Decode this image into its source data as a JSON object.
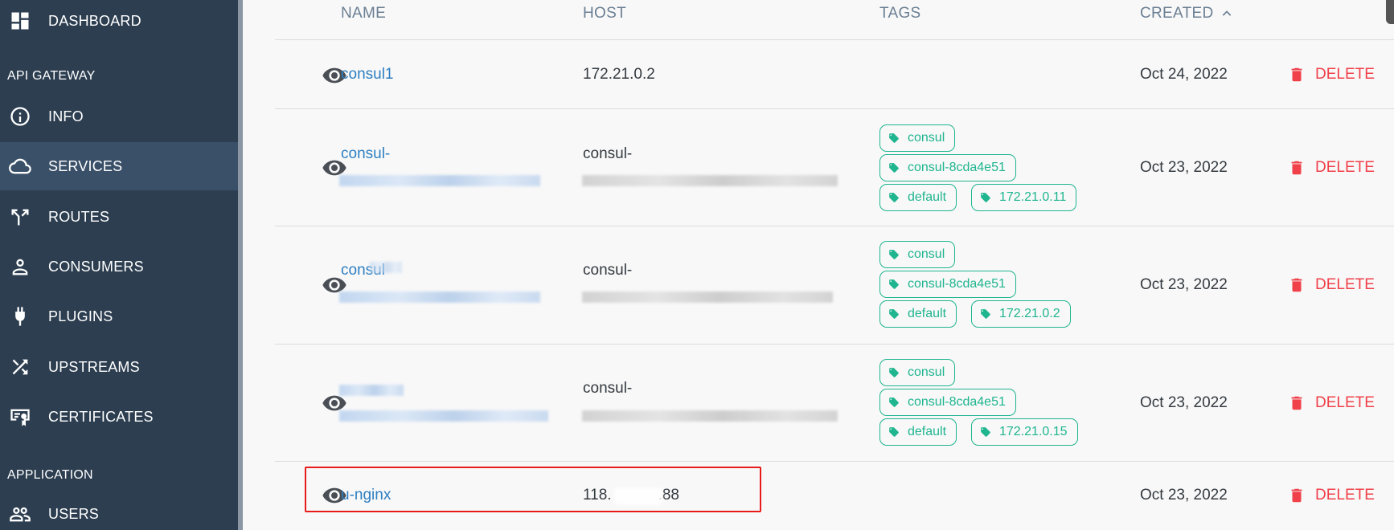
{
  "sidebar": {
    "items": [
      {
        "label": "DASHBOARD",
        "icon": "dashboard-icon"
      },
      {
        "label": "INFO",
        "icon": "info-icon"
      },
      {
        "label": "SERVICES",
        "icon": "cloud-icon"
      },
      {
        "label": "ROUTES",
        "icon": "routes-icon"
      },
      {
        "label": "CONSUMERS",
        "icon": "person-icon"
      },
      {
        "label": "PLUGINS",
        "icon": "plug-icon"
      },
      {
        "label": "UPSTREAMS",
        "icon": "shuffle-icon"
      },
      {
        "label": "CERTIFICATES",
        "icon": "certificate-icon"
      },
      {
        "label": "USERS",
        "icon": "users-icon"
      }
    ],
    "sections": {
      "api_gateway": "API GATEWAY",
      "application": "APPLICATION"
    },
    "active_item": "SERVICES"
  },
  "table": {
    "headers": {
      "name": "NAME",
      "host": "HOST",
      "tags": "TAGS",
      "created": "CREATED"
    },
    "sort": {
      "column": "CREATED",
      "direction": "ascending"
    },
    "delete_label": "DELETE",
    "rows": [
      {
        "name": "consul1",
        "host": "172.21.0.2",
        "tags": [],
        "created": "Oct 24, 2022"
      },
      {
        "name": "consul-",
        "host": "consul-",
        "tags": [
          "consul",
          "consul-8cda4e51",
          "default",
          "172.21.0.11"
        ],
        "created": "Oct 23, 2022"
      },
      {
        "name": "consul",
        "host": "consul-",
        "tags": [
          "consul",
          "consul-8cda4e51",
          "default",
          "172.21.0.2"
        ],
        "created": "Oct 23, 2022"
      },
      {
        "name": "",
        "host": "consul-",
        "tags": [
          "consul",
          "consul-8cda4e51",
          "default",
          "172.21.0.15"
        ],
        "created": "Oct 23, 2022"
      },
      {
        "name": "u-nginx",
        "host_prefix": "118.",
        "host_suffix": ".88",
        "tags": [],
        "created": "Oct 23, 2022"
      }
    ]
  },
  "colors": {
    "sidebar_bg": "#2c3e50",
    "sidebar_active": "#3a5068",
    "link": "#2e7fc1",
    "tag": "#1fb58f",
    "delete": "#f0414a",
    "highlight": "#e81b1b"
  }
}
